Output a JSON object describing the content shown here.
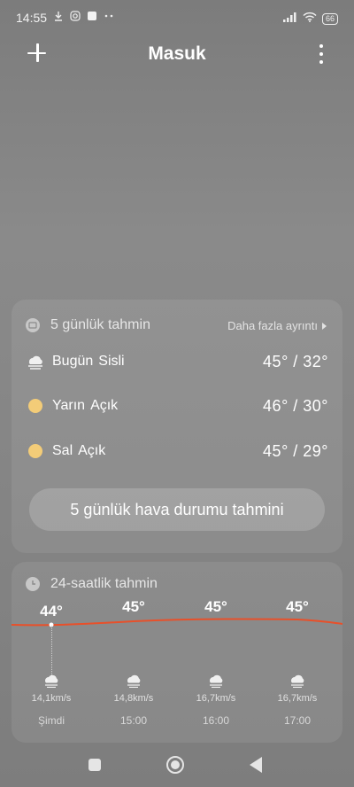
{
  "status_bar": {
    "time": "14:55",
    "battery": "66",
    "icons": [
      "download-icon",
      "instagram-icon",
      "app-icon",
      "dots-icon",
      "signal-icon",
      "wifi-icon",
      "battery-icon"
    ]
  },
  "header": {
    "title": "Masuk",
    "add_icon": "plus-icon",
    "menu_icon": "more-vertical-icon"
  },
  "daily": {
    "title": "5 günlük tahmin",
    "more_link": "Daha fazla ayrıntı",
    "days": [
      {
        "label": "Bugün",
        "condition": "Sisli",
        "temp": "45° / 32°",
        "icon": "fog-icon"
      },
      {
        "label": "Yarın",
        "condition": "Açık",
        "temp": "46° / 30°",
        "icon": "sun-icon"
      },
      {
        "label": "Sal",
        "condition": "Açık",
        "temp": "45° / 29°",
        "icon": "sun-icon"
      }
    ],
    "button_label": "5 günlük hava durumu tahmini"
  },
  "hourly": {
    "title": "24-saatlik tahmin",
    "hours": [
      {
        "temp": "44°",
        "wind": "14,1km/s",
        "label": "Şimdi",
        "icon": "fog-icon"
      },
      {
        "temp": "45°",
        "wind": "14,8km/s",
        "label": "15:00",
        "icon": "fog-icon"
      },
      {
        "temp": "45°",
        "wind": "16,7km/s",
        "label": "16:00",
        "icon": "fog-icon"
      },
      {
        "temp": "45°",
        "wind": "16,7km/s",
        "label": "17:00",
        "icon": "fog-icon"
      }
    ],
    "trend_color": "#e8502a"
  },
  "colors": {
    "sun": "#f3cc78",
    "background": "#858585"
  }
}
